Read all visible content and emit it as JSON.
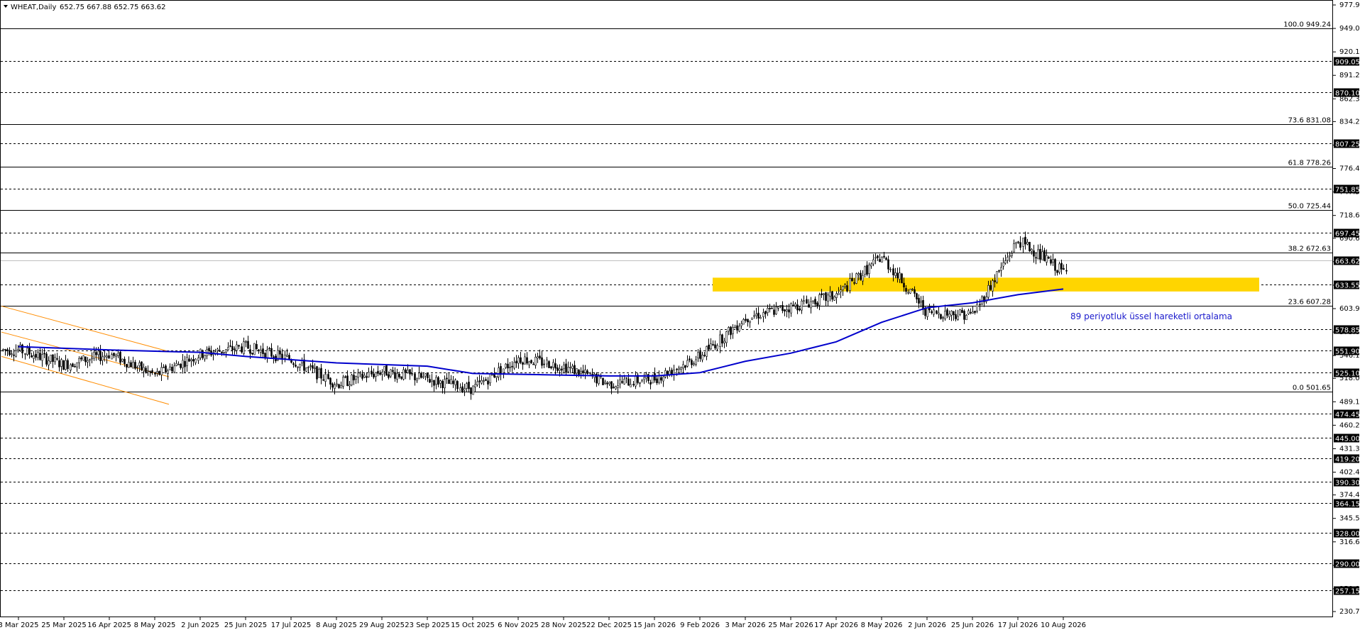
{
  "header": {
    "symbol": "WHEAT,Daily",
    "ohlc": "652.75 667.88 652.75 663.62"
  },
  "annotation": "89 periyotluk üssel hareketli ortalama",
  "colors": {
    "background": "#ffffff",
    "bull_candle": "#ffffff",
    "bear_candle": "#000000",
    "ema": "#0000cc",
    "zone": "#ffd500",
    "channel": "#ff8c00",
    "annotation": "#1a1acc"
  },
  "chart_data": {
    "type": "candlestick",
    "ylim": [
      230.75,
      977.9
    ],
    "y_ticks": [
      "977.90",
      "949.00",
      "920.10",
      "891.20",
      "862.30",
      "834.25",
      "805.35",
      "776.45",
      "747.55",
      "718.65",
      "690.60",
      "661.70",
      "632.80",
      "603.90",
      "575.00",
      "546.10",
      "518.05",
      "489.15",
      "460.25",
      "431.35",
      "402.45",
      "374.40",
      "345.50",
      "316.60",
      "287.70",
      "258.80",
      "230.75"
    ],
    "x_labels": [
      "3 Mar 2025",
      "25 Mar 2025",
      "16 Apr 2025",
      "8 May 2025",
      "2 Jun 2025",
      "25 Jun 2025",
      "17 Jul 2025",
      "8 Aug 2025",
      "29 Aug 2025",
      "23 Sep 2025",
      "15 Oct 2025",
      "6 Nov 2025",
      "28 Nov 2025",
      "22 Dec 2025",
      "15 Jan 2026",
      "9 Feb 2026",
      "3 Mar 2026",
      "25 Mar 2026",
      "17 Apr 2026",
      "8 May 2026",
      "2 Jun 2026",
      "25 Jun 2026",
      "17 Jul 2026",
      "10 Aug 2026"
    ],
    "fib_levels": [
      {
        "label": "100.0 949.24",
        "value": 949.24
      },
      {
        "label": "73.6 831.08",
        "value": 831.08
      },
      {
        "label": "61.8 778.26",
        "value": 778.26
      },
      {
        "label": "50.0 725.44",
        "value": 725.44
      },
      {
        "label": "38.2 672.63",
        "value": 672.63
      },
      {
        "label": "23.6 607.28",
        "value": 607.28
      },
      {
        "label": "0.0 501.65",
        "value": 501.65
      }
    ],
    "horizontal_levels": [
      "909.05",
      "870.10",
      "807.25",
      "751.85",
      "697.45",
      "633.55",
      "578.85",
      "551.90",
      "525.10",
      "474.45",
      "445.00",
      "419.20",
      "390.30",
      "364.15",
      "328.00",
      "290.00",
      "257.15"
    ],
    "current_price": "663.62",
    "support_zone": {
      "from": 625.0,
      "to": 642.0
    },
    "channel_lines": [
      {
        "start": {
          "x": "3 Mar 2025",
          "y": 607
        },
        "end": {
          "x": "8 May 2025",
          "y": 551
        }
      },
      {
        "start": {
          "x": "3 Mar 2025",
          "y": 575
        },
        "end": {
          "x": "8 May 2025",
          "y": 520
        }
      },
      {
        "start": {
          "x": "3 Mar 2025",
          "y": 545
        },
        "end": {
          "x": "8 May 2025",
          "y": 486
        }
      }
    ],
    "ema_path": [
      {
        "x": "3 Mar 2025",
        "y": 557
      },
      {
        "x": "16 Apr 2025",
        "y": 553
      },
      {
        "x": "2 Jun 2025",
        "y": 550
      },
      {
        "x": "25 Jun 2025",
        "y": 545
      },
      {
        "x": "8 Aug 2025",
        "y": 537
      },
      {
        "x": "23 Sep 2025",
        "y": 533
      },
      {
        "x": "15 Oct 2025",
        "y": 524
      },
      {
        "x": "28 Nov 2025",
        "y": 522
      },
      {
        "x": "22 Dec 2025",
        "y": 521
      },
      {
        "x": "15 Jan 2026",
        "y": 521
      },
      {
        "x": "9 Feb 2026",
        "y": 525
      },
      {
        "x": "3 Mar 2026",
        "y": 539
      },
      {
        "x": "25 Mar 2026",
        "y": 549
      },
      {
        "x": "17 Apr 2026",
        "y": 563
      },
      {
        "x": "8 May 2026",
        "y": 587
      },
      {
        "x": "2 Jun 2026",
        "y": 605
      },
      {
        "x": "25 Jun 2026",
        "y": 611
      },
      {
        "x": "17 Jul 2026",
        "y": 621
      },
      {
        "x": "10 Aug 2026",
        "y": 628
      }
    ],
    "price_path": [
      {
        "x": "3 Mar 2025",
        "y": 553
      },
      {
        "x": "25 Mar 2025",
        "y": 535
      },
      {
        "x": "16 Apr 2025",
        "y": 548
      },
      {
        "x": "8 May 2025",
        "y": 522
      },
      {
        "x": "2 Jun 2025",
        "y": 548
      },
      {
        "x": "25 Jun 2025",
        "y": 557
      },
      {
        "x": "17 Jul 2025",
        "y": 541
      },
      {
        "x": "8 Aug 2025",
        "y": 511
      },
      {
        "x": "29 Aug 2025",
        "y": 527
      },
      {
        "x": "23 Sep 2025",
        "y": 517
      },
      {
        "x": "15 Oct 2025",
        "y": 505
      },
      {
        "x": "6 Nov 2025",
        "y": 543
      },
      {
        "x": "28 Nov 2025",
        "y": 533
      },
      {
        "x": "22 Dec 2025",
        "y": 511
      },
      {
        "x": "15 Jan 2026",
        "y": 518
      },
      {
        "x": "9 Feb 2026",
        "y": 545
      },
      {
        "x": "3 Mar 2026",
        "y": 593
      },
      {
        "x": "25 Mar 2026",
        "y": 606
      },
      {
        "x": "17 Apr 2026",
        "y": 620
      },
      {
        "x": "8 May 2026",
        "y": 668
      },
      {
        "x": "2 Jun 2026",
        "y": 599
      },
      {
        "x": "25 Jun 2026",
        "y": 597
      },
      {
        "x": "17 Jul 2026",
        "y": 688
      },
      {
        "x": "10 Aug 2026",
        "y": 649
      }
    ]
  }
}
